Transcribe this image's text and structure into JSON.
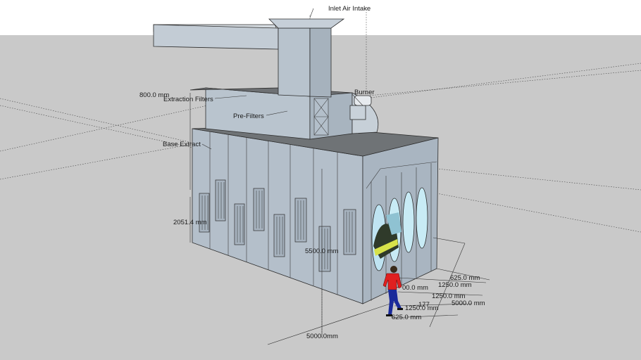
{
  "labels": {
    "inlet_air_intake": "Inlet Air Intake",
    "burner": "Burner",
    "extraction_filters": "Extraction Filters",
    "pre_filters": "Pre-Filters",
    "base_extract": "Base Extract"
  },
  "dimensions": {
    "d_800": "800.0 mm",
    "d_2051": "2051.4 mm",
    "d_5500": "5500.0 mm",
    "d_625_top": "625.0 mm",
    "d_1250_a": "1250.0 mm",
    "d_1000": "00.0 mm",
    "d_1250_b": "1250.0 mm",
    "d_1775": "177",
    "d_6000": "5000.0 mm",
    "d_1250_c": "1250.0 mm",
    "d_625_bottom": "625.0 mm",
    "d_5000": "5000.0mm"
  },
  "colors": {
    "sky": "#ffffff",
    "ground": "#c9c9c9",
    "wall": "#b6c1cc",
    "wall_dark": "#9eabb7",
    "roof": "#6f7275",
    "glass": "#bfe4f2",
    "person_shirt": "#e02020",
    "person_pants": "#1a2a9a"
  }
}
